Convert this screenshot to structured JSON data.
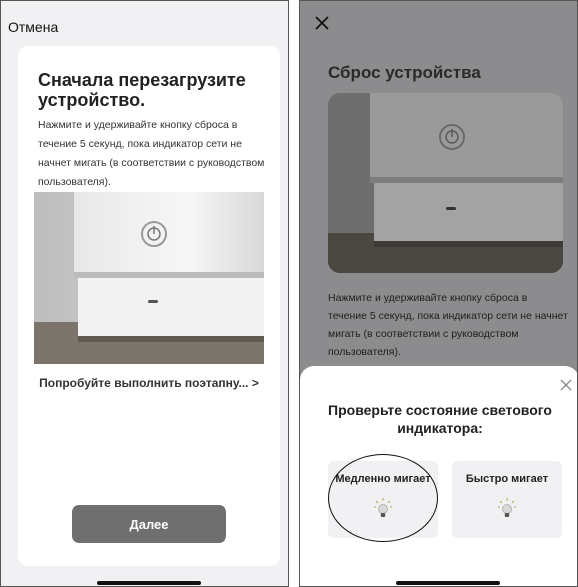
{
  "left_screen": {
    "cancel_label": "Отмена",
    "title": "Сначала перезагрузите устройство.",
    "description": "Нажмите и удерживайте кнопку сброса в течение 5 секунд, пока индикатор сети не начнет мигать  (в соответствии с руководством пользователя).",
    "try_link": "Попробуйте выполнить поэтапну...",
    "try_link_chevron": ">",
    "next_button": "Далее",
    "image_icon": "device-photo"
  },
  "right_screen": {
    "close_icon": "close-icon",
    "title": "Сброс устройства",
    "description": "Нажмите и удерживайте кнопку сброса в течение 5 секунд, пока индикатор сети не начнет мигать  (в соответствии с руководством пользователя).",
    "image_icon": "device-photo",
    "sheet": {
      "title": "Проверьте состояние светового индикатора:",
      "options": [
        {
          "label": "Медленно мигает",
          "icon": "bulb-icon",
          "highlighted": true
        },
        {
          "label": "Быстро мигает",
          "icon": "bulb-icon",
          "highlighted": false
        }
      ]
    }
  },
  "colors": {
    "primary_button": "#6f6f6f",
    "dimmed_overlay": "#8c8c8e",
    "card_background": "#ffffff",
    "option_background": "#f1f1f3"
  }
}
